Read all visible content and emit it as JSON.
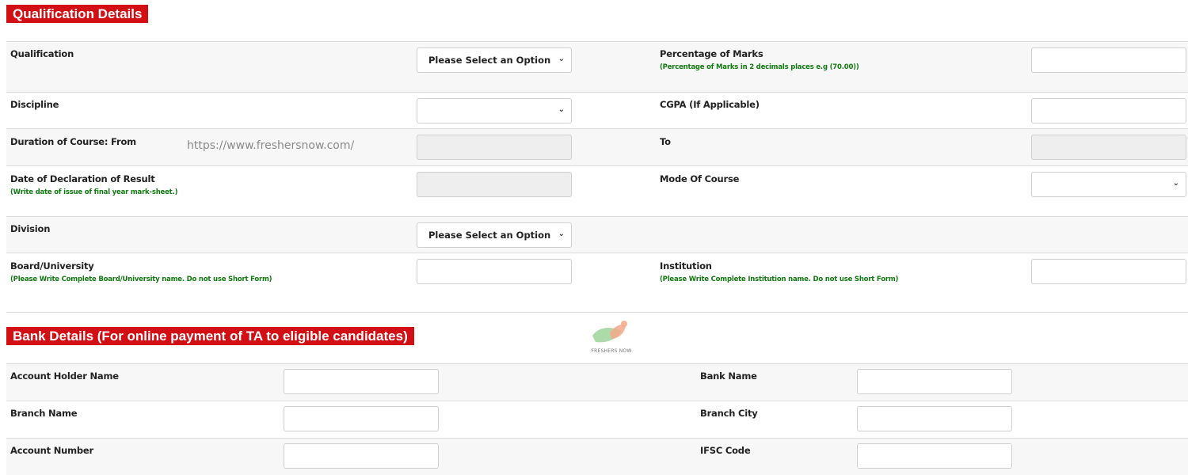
{
  "qualification_section": {
    "title": "Qualification Details",
    "fields": {
      "qualification": {
        "label": "Qualification",
        "value": "Please Select an Option"
      },
      "percentage": {
        "label": "Percentage of Marks",
        "hint": "(Percentage of Marks in 2 decimals places e.g (70.00))",
        "value": ""
      },
      "discipline": {
        "label": "Discipline",
        "value": ""
      },
      "cgpa": {
        "label": "CGPA (If Applicable)",
        "value": ""
      },
      "duration_from": {
        "label": "Duration of Course: From",
        "value": ""
      },
      "duration_to": {
        "label": "To",
        "value": ""
      },
      "declaration_date": {
        "label": "Date of Declaration of Result",
        "hint": "(Write date of issue of final year mark-sheet.)",
        "value": ""
      },
      "mode_of_course": {
        "label": "Mode Of Course",
        "value": ""
      },
      "division": {
        "label": "Division",
        "value": "Please Select an Option"
      },
      "board_university": {
        "label": "Board/University",
        "hint": "(Please Write Complete Board/University name. Do not use Short Form)",
        "value": ""
      },
      "institution": {
        "label": "Institution",
        "hint": "(Please Write Complete Institution name. Do not use Short Form)",
        "value": ""
      }
    }
  },
  "bank_section": {
    "title": "Bank Details (For online payment of TA to eligible candidates)",
    "fields": {
      "account_holder": {
        "label": "Account Holder Name",
        "value": ""
      },
      "bank_name": {
        "label": "Bank Name",
        "value": ""
      },
      "branch_name": {
        "label": "Branch Name",
        "value": ""
      },
      "branch_city": {
        "label": "Branch City",
        "value": ""
      },
      "account_number": {
        "label": "Account Number",
        "value": ""
      },
      "ifsc": {
        "label": "IFSC Code",
        "value": ""
      }
    }
  },
  "watermark": {
    "url": "https://www.freshersnow.com/",
    "logo_text": "FRESHERS NOW"
  },
  "icons": {
    "dropdown": "chevron-down-icon"
  },
  "colors": {
    "header_bg": "#d10f15",
    "hint_text": "#117a11"
  }
}
